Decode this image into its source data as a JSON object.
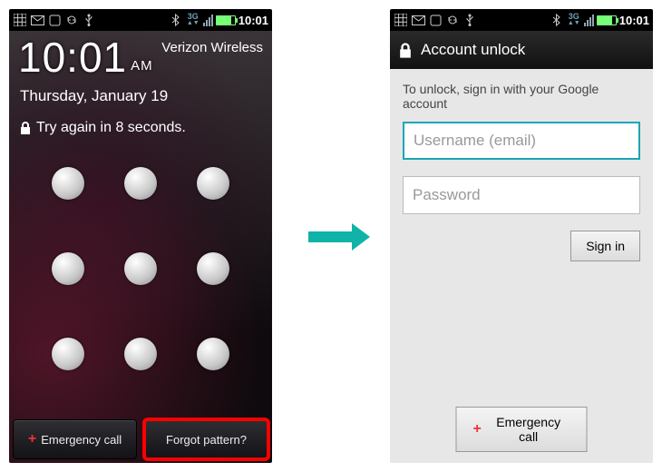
{
  "status": {
    "time": "10:01",
    "network_label": "3G"
  },
  "lock": {
    "time": "10:01",
    "ampm": "AM",
    "carrier": "Verizon Wireless",
    "date": "Thursday, January 19",
    "retry": "Try again in 8 seconds.",
    "emergency": "Emergency call",
    "forgot": "Forgot pattern?"
  },
  "unlock": {
    "title": "Account unlock",
    "prompt": "To unlock, sign in with your Google account",
    "username_placeholder": "Username (email)",
    "password_placeholder": "Password",
    "signin": "Sign in",
    "emergency": "Emergency call"
  }
}
